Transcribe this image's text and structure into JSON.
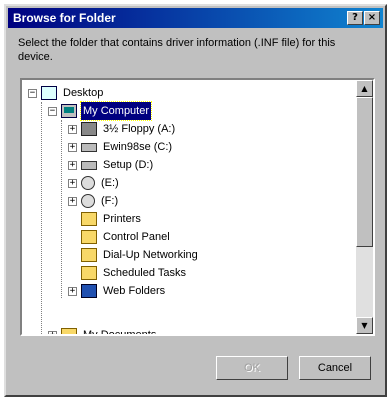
{
  "window": {
    "title": "Browse for Folder",
    "help_glyph": "?",
    "close_glyph": "×"
  },
  "instruction": "Select the folder that contains driver information (.INF file) for this device.",
  "tree": {
    "items": [
      {
        "label": "Desktop",
        "icon": "desktop-icon",
        "expander": "−"
      },
      {
        "label": "My Computer",
        "icon": "my-computer-icon",
        "expander": "−",
        "selected": true
      },
      {
        "label": "3½ Floppy (A:)",
        "icon": "floppy-drive-icon",
        "expander": "+"
      },
      {
        "label": "Ewin98se (C:)",
        "icon": "hard-drive-icon",
        "expander": "+"
      },
      {
        "label": "Setup (D:)",
        "icon": "hard-drive-icon",
        "expander": "+"
      },
      {
        "label": "(E:)",
        "icon": "cd-drive-icon",
        "expander": "+"
      },
      {
        "label": "(F:)",
        "icon": "cd-drive-icon",
        "expander": "+"
      },
      {
        "label": "Printers",
        "icon": "printers-folder-icon",
        "expander": ""
      },
      {
        "label": "Control Panel",
        "icon": "control-panel-folder-icon",
        "expander": ""
      },
      {
        "label": "Dial-Up Networking",
        "icon": "dial-up-networking-folder-icon",
        "expander": ""
      },
      {
        "label": "Scheduled Tasks",
        "icon": "scheduled-tasks-folder-icon",
        "expander": ""
      },
      {
        "label": "Web Folders",
        "icon": "web-folders-icon",
        "expander": "+"
      },
      {
        "label": "My Documents",
        "icon": "my-documents-icon",
        "expander": "+"
      }
    ]
  },
  "scrollbar": {
    "up_glyph": "▲",
    "down_glyph": "▼"
  },
  "buttons": {
    "ok": "OK",
    "cancel": "Cancel"
  }
}
